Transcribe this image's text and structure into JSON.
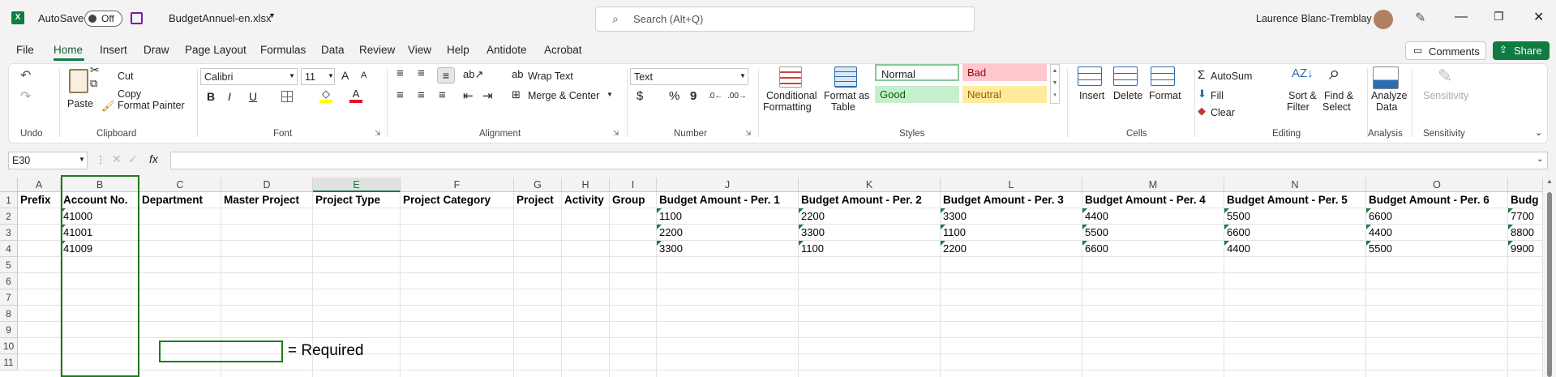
{
  "titlebar": {
    "autosave_label": "AutoSave",
    "autosave_state": "Off",
    "filename": "BudgetAnnuel-en.xlsx",
    "search_placeholder": "Search (Alt+Q)",
    "user_name": "Laurence Blanc-Tremblay"
  },
  "menu_tabs": [
    "File",
    "Home",
    "Insert",
    "Draw",
    "Page Layout",
    "Formulas",
    "Data",
    "Review",
    "View",
    "Help",
    "Antidote",
    "Acrobat"
  ],
  "active_tab": "Home",
  "comments_label": "Comments",
  "share_label": "Share",
  "ribbon": {
    "undo_group": "Undo",
    "clipboard": {
      "paste": "Paste",
      "cut": "Cut",
      "copy": "Copy",
      "format_painter": "Format Painter",
      "group": "Clipboard"
    },
    "font": {
      "name": "Calibri",
      "size": "11",
      "bold": "B",
      "italic": "I",
      "underline": "U",
      "group": "Font",
      "grow": "A",
      "shrink": "A"
    },
    "alignment": {
      "wrap_text": "Wrap Text",
      "merge_center": "Merge & Center",
      "group": "Alignment"
    },
    "number": {
      "format": "Text",
      "currency": "$",
      "percent": "%",
      "comma": "9",
      "group": "Number"
    },
    "styles": {
      "conditional_formatting": [
        "Conditional",
        "Formatting"
      ],
      "format_as_table": [
        "Format as",
        "Table"
      ],
      "normal": "Normal",
      "bad": "Bad",
      "good": "Good",
      "neutral": "Neutral",
      "group": "Styles"
    },
    "cells": {
      "insert": "Insert",
      "delete": "Delete",
      "format": "Format",
      "group": "Cells"
    },
    "editing": {
      "autosum": "AutoSum",
      "fill": "Fill",
      "clear": "Clear",
      "sort_filter": [
        "Sort &",
        "Filter"
      ],
      "find_select": [
        "Find &",
        "Select"
      ],
      "group": "Editing"
    },
    "analysis": {
      "analyze_data": [
        "Analyze",
        "Data"
      ],
      "group": "Analysis"
    },
    "sensitivity": {
      "label": "Sensitivity",
      "group": "Sensitivity"
    }
  },
  "formula_bar": {
    "name_box": "E30",
    "fx": "fx",
    "value": ""
  },
  "columns": [
    "A",
    "B",
    "C",
    "D",
    "E",
    "F",
    "G",
    "H",
    "I",
    "J",
    "K",
    "L",
    "M",
    "N",
    "O"
  ],
  "rows": [
    "1",
    "2",
    "3",
    "4",
    "5",
    "6",
    "7",
    "8",
    "9",
    "10",
    "11"
  ],
  "headers": [
    "Prefix",
    "Account No.",
    "Department",
    "Master Project",
    "Project Type",
    "Project Category",
    "Project",
    "Activity",
    "Group",
    "Budget Amount - Per. 1",
    "Budget Amount - Per. 2",
    "Budget Amount - Per. 3",
    "Budget Amount - Per. 4",
    "Budget Amount - Per. 5",
    "Budget Amount - Per. 6",
    "Budg"
  ],
  "data_rows": [
    {
      "account": "41000",
      "amounts": [
        "1100",
        "2200",
        "3300",
        "4400",
        "5500",
        "6600",
        "7700"
      ]
    },
    {
      "account": "41001",
      "amounts": [
        "2200",
        "3300",
        "1100",
        "5500",
        "6600",
        "4400",
        "8800"
      ]
    },
    {
      "account": "41009",
      "amounts": [
        "3300",
        "1100",
        "2200",
        "6600",
        "4400",
        "5500",
        "9900"
      ]
    }
  ],
  "legend_text": "= Required",
  "colors": {
    "excel_green": "#107c41",
    "required_border": "#1e7b1e",
    "bad_bg": "#ffc7ce",
    "good_bg": "#c6efce",
    "neutral_bg": "#ffeb9c"
  }
}
